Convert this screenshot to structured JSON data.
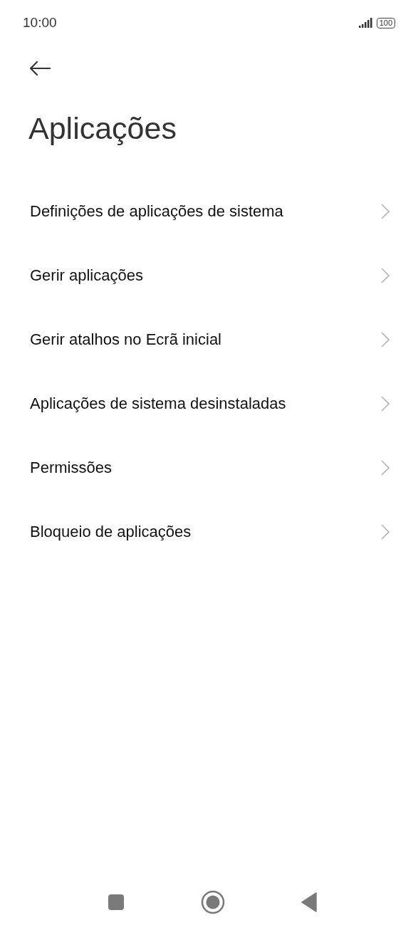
{
  "status_bar": {
    "time": "10:00",
    "battery": "100"
  },
  "title": "Aplicações",
  "items": [
    {
      "label": "Definições de aplicações de sistema"
    },
    {
      "label": "Gerir aplicações"
    },
    {
      "label": "Gerir atalhos no Ecrã inicial"
    },
    {
      "label": "Aplicações de sistema desinstaladas"
    },
    {
      "label": "Permissões"
    },
    {
      "label": "Bloqueio de aplicações"
    }
  ]
}
